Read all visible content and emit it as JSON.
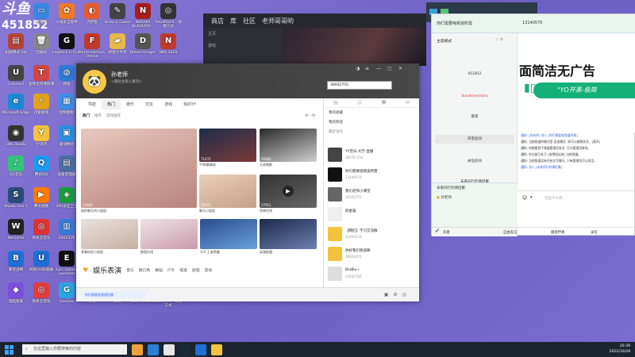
{
  "watermark": {
    "logo": "斗鱼",
    "room_id": "451852"
  },
  "desktop_icons": [
    {
      "label": "此电脑",
      "color": "#3b86e0",
      "glyph": "▭"
    },
    {
      "label": "火绒安全软件",
      "color": "#f07a26",
      "glyph": "✿"
    },
    {
      "label": "内存管",
      "color": "#e95a30",
      "glyph": "◐"
    },
    {
      "label": "Draw & Guess",
      "color": "#444",
      "glyph": "✎"
    },
    {
      "label": "NARAKA BLADEPOI...",
      "color": "#a61e1e",
      "glyph": "N"
    },
    {
      "label": "TotalMixFX - 快捷方式",
      "color": "#333",
      "glyph": "◎"
    },
    {
      "label": "扣屏模式.lnk",
      "color": "#b5433a",
      "glyph": "▤"
    },
    {
      "label": "回收站",
      "color": "#888",
      "glyph": "🗑"
    },
    {
      "label": "Logitech G HUB",
      "color": "#111",
      "glyph": "G"
    },
    {
      "label": "Forza Horizon Online",
      "color": "#c0392b",
      "glyph": "F"
    },
    {
      "label": "新建文件夹",
      "color": "#e8b84a",
      "glyph": "▰"
    },
    {
      "label": "Dread Hunger",
      "color": "#555",
      "glyph": "D"
    },
    {
      "label": "NBA 2K20",
      "color": "#c0392b",
      "glyph": "N"
    },
    {
      "label": "Unheard",
      "color": "#444",
      "glyph": "U"
    },
    {
      "label": "金牌主持课授课",
      "color": "#d24545",
      "glyph": "T"
    },
    {
      "label": "网络",
      "color": "#2e7bd6",
      "glyph": "◍"
    },
    {
      "label": "Microsoft Edge",
      "color": "#1a8ad4",
      "glyph": "e"
    },
    {
      "label": "迅雷极简",
      "color": "#e0a31a",
      "glyph": "⚡"
    },
    {
      "label": "控制面板",
      "color": "#3e8ee6",
      "glyph": "▦"
    },
    {
      "label": "OBS Studio",
      "color": "#333",
      "glyph": "◉"
    },
    {
      "label": "YY语音",
      "color": "#f3c33d",
      "glyph": "Y"
    },
    {
      "label": "驱动精灵",
      "color": "#2b8fe0",
      "glyph": "▣"
    },
    {
      "label": "QQ音乐",
      "color": "#33c37b",
      "glyph": "♪"
    },
    {
      "label": "腾讯QQ",
      "color": "#1d9bf0",
      "glyph": "Q"
    },
    {
      "label": "设备管理器",
      "color": "#4a6fa5",
      "glyph": "▤"
    },
    {
      "label": "Studio One 5",
      "color": "#2a4a7a",
      "glyph": "S"
    },
    {
      "label": "腾讯视频",
      "color": "#ff7a00",
      "glyph": "▶"
    },
    {
      "label": "360安全卫士",
      "color": "#1a9c3c",
      "glyph": "◈"
    },
    {
      "label": "WeGame",
      "color": "#222",
      "glyph": "W"
    },
    {
      "label": "网易云音乐",
      "color": "#d33",
      "glyph": "◎"
    },
    {
      "label": "2002工作",
      "color": "#3a7ad6",
      "glyph": "▥"
    },
    {
      "label": "暴雪战网",
      "color": "#1f6fd6",
      "glyph": "B"
    },
    {
      "label": "网易UU加速器",
      "color": "#1d6dd4",
      "glyph": "U"
    },
    {
      "label": "Epic Games Launcher",
      "color": "#111",
      "glyph": "E"
    },
    {
      "label": "电脑管家",
      "color": "#7a4fe0",
      "glyph": "◆"
    },
    {
      "label": "网易云游戏",
      "color": "#e23d3d",
      "glyph": "◎"
    },
    {
      "label": "GeeGee",
      "color": "#2aa6e0",
      "glyph": "G"
    },
    {
      "label": "抖音",
      "color": "#111",
      "glyph": "♪"
    },
    {
      "label": "微信",
      "color": "#2aae67",
      "glyph": "✉"
    },
    {
      "label": "Catch a Lover",
      "color": "#e76aa5",
      "glyph": "♥"
    },
    {
      "label": "Launcher - 快捷方式",
      "color": "#b91c1c",
      "glyph": "L"
    },
    {
      "label": "Steam - 快捷方式",
      "color": "#1b2838",
      "glyph": "S"
    },
    {
      "label": "优雅·待爱.mp3",
      "color": "#eee",
      "glyph": "♫"
    },
    {
      "label": "绿野精灵 -1v5Hot...",
      "color": "#555",
      "glyph": "◉"
    }
  ],
  "dark_window": {
    "tabs": [
      "商店",
      "库",
      "社区",
      "老师哥哥哟"
    ],
    "side_items": [
      "主页",
      "游戏"
    ]
  },
  "yy": {
    "user_name": "孙老师",
    "user_sig": "<愿此生能入墨流>",
    "search_value": "38042755",
    "tabs": [
      "导航",
      "热门",
      "娱乐",
      "交友",
      "游戏",
      "我的YY"
    ],
    "active_tab": "热门",
    "subtabs": [
      "热门",
      "推荐",
      "游戏推荐"
    ],
    "refresh": "换一换",
    "tiles": [
      {
        "caption": "陪你聊天的小姐姐",
        "count": "13600",
        "color1": "#e9c8bd",
        "color2": "#b88479"
      },
      {
        "caption": "YY新歌精选",
        "count": "71472",
        "color1": "#1d2d4a",
        "color2": "#7b3a3a"
      },
      {
        "caption": "大叔唱歌",
        "count": "50682",
        "color1": "#2a2a2a",
        "color2": "#d0d0d0"
      },
      {
        "caption": "聊天小姐姐",
        "count": "20201",
        "color1": "#e7d0bb",
        "color2": "#c79f8a"
      },
      {
        "caption": "男神在线",
        "count": "57911",
        "color1": "#333",
        "color2": "#666"
      },
      {
        "caption": "青春校花小姐姐",
        "count": "",
        "color1": "#e8e1dc",
        "color2": "#c7b0a4"
      },
      {
        "caption": "颜值在线",
        "count": "",
        "color1": "#efe3e8",
        "color2": "#c99aaa"
      },
      {
        "caption": "1v5 王者荣耀",
        "count": "",
        "color1": "#2a4c8a",
        "color2": "#6aa0e0"
      },
      {
        "caption": "英雄联盟",
        "count": "",
        "color1": "#1b2a4a",
        "color2": "#6c7fb0"
      }
    ],
    "section_title": "娱乐表演",
    "section_cats": [
      "音乐",
      "脱口秀",
      "舞蹈",
      "户外",
      "喊麦",
      "颜值",
      "其他"
    ],
    "ticker": "你们需要啥频道所需",
    "right_rows": [
      "我的收藏",
      "我的频道",
      "最近访问"
    ],
    "right_items": [
      {
        "title": "YY音乐·大厅·直播",
        "sub": "38078.37w",
        "color": "#444"
      },
      {
        "title": "你们需要啥频道所需",
        "sub": "13140570",
        "color": "#111"
      },
      {
        "title": "我们老师小课堂",
        "sub": "38342755",
        "color": "#666"
      },
      {
        "title": "四金猫",
        "sub": "",
        "color": "#eee"
      },
      {
        "title": "【网红】学习交流群",
        "sub": "42093534",
        "color": "#f3c33d"
      },
      {
        "title": "你好我们频道聊",
        "sub": "39026455",
        "color": "#f3c33d"
      },
      {
        "title": "BluBlu~",
        "sub": "14562780",
        "color": "#ddd"
      }
    ]
  },
  "channel": {
    "title": "你们需要啥频道所需",
    "id": "13140570",
    "mode": "主席模式",
    "mode_tools": "☆ ⚙",
    "list": [
      "451852",
      "Sunshine小Lhu",
      "嘉宾",
      "开黑房间",
      "永恒房间",
      "未来同行的情侣聚"
    ],
    "highlighted": "开黑房间",
    "banner_text": "面简洁无广告",
    "banner_pill": "\"YO开黑-极简",
    "messages": [
      {
        "cls": "b",
        "text": "通知: [你老师] 进入 [你们需要啥频道所需]"
      },
      {
        "cls": "",
        "text": "通知: 当前频道的模式是 自由模式, 你可以随意发言。[离开]"
      },
      {
        "cls": "",
        "text": "通知: 你能看到子频道管理员发言, 可与管理员联系。"
      },
      {
        "cls": "",
        "text": "通知: 你当前已处于 [金牌陪玩房] 当前频道。"
      },
      {
        "cls": "",
        "text": "通知: 当前频道没有开启文字聊天, 只有管理员可以发言。"
      },
      {
        "cls": "b",
        "text": "通知: 进入 [未来同行的情侣聚]"
      }
    ],
    "input_placeholder": "说些什么吧...",
    "member_title": "未来同行的情侣聚",
    "member_list": "孙老师",
    "foot_items": [
      "开麦",
      "自由发言",
      "播放伴奏",
      "录音"
    ]
  },
  "taskbar": {
    "search_placeholder": "在这里输入你要搜索的内容",
    "time": "20:39",
    "date": "2022/10/28",
    "pinned_colors": [
      "#f0a23a",
      "#2a7fd6",
      "#e6e6e6",
      "#1b2838",
      "#1f6fd6",
      "#f3c33d"
    ]
  }
}
